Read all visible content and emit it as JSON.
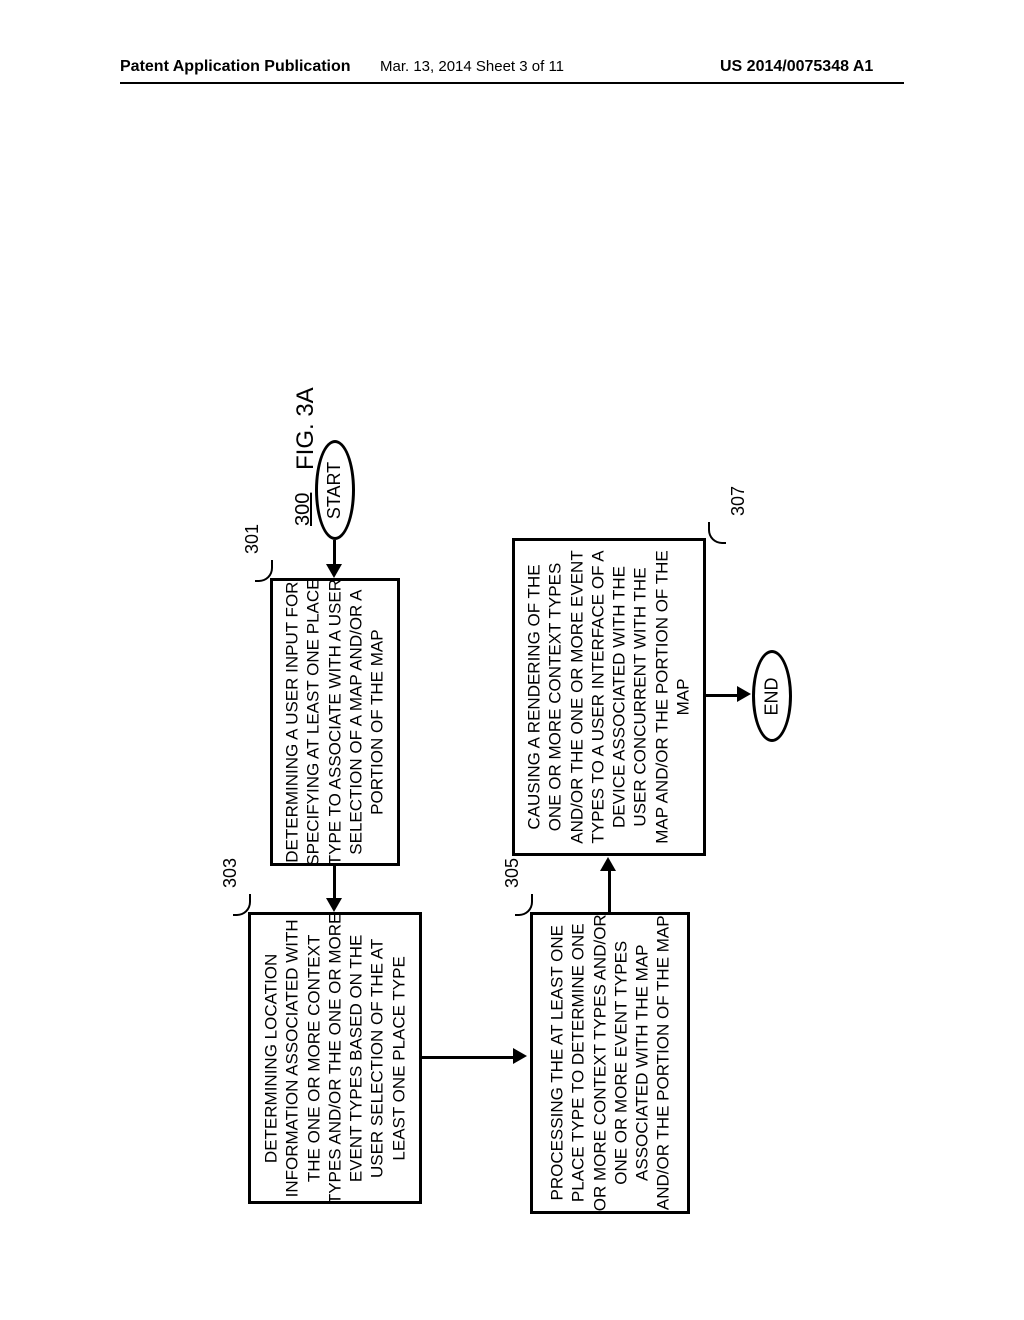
{
  "header": {
    "left": "Patent Application Publication",
    "center": "Mar. 13, 2014  Sheet 3 of 11",
    "right": "US 2014/0075348 A1"
  },
  "figure": {
    "title": "FIG. 3A",
    "number": "300"
  },
  "nodes": {
    "start": "START",
    "end": "END",
    "s301": "DETERMINING A USER INPUT FOR\nSPECIFYING AT LEAST ONE PLACE\nTYPE TO ASSOCIATE WITH A USER\nSELECTION OF A MAP AND/OR A\nPORTION OF THE MAP",
    "s303": "DETERMINING LOCATION\nINFORMATION ASSOCIATED WITH\nTHE ONE OR MORE CONTEXT\nTYPES AND/OR THE ONE OR MORE\nEVENT TYPES BASED ON THE\nUSER SELECTION OF THE AT\nLEAST ONE PLACE TYPE",
    "s305": "PROCESSING THE AT LEAST ONE\nPLACE TYPE TO DETERMINE ONE\nOR MORE CONTEXT TYPES AND/OR\nONE OR MORE EVENT TYPES\nASSOCIATED WITH THE MAP\nAND/OR THE PORTION OF THE MAP",
    "s307": "CAUSING A RENDERING OF THE\nONE OR MORE CONTEXT TYPES\nAND/OR THE ONE OR MORE EVENT\nTYPES TO A USER INTERFACE OF A\nDEVICE ASSOCIATED WITH THE\nUSER CONCURRENT WITH THE\nMAP AND/OR THE PORTION OF THE\nMAP"
  },
  "refs": {
    "r301": "301",
    "r303": "303",
    "r305": "305",
    "r307": "307"
  }
}
